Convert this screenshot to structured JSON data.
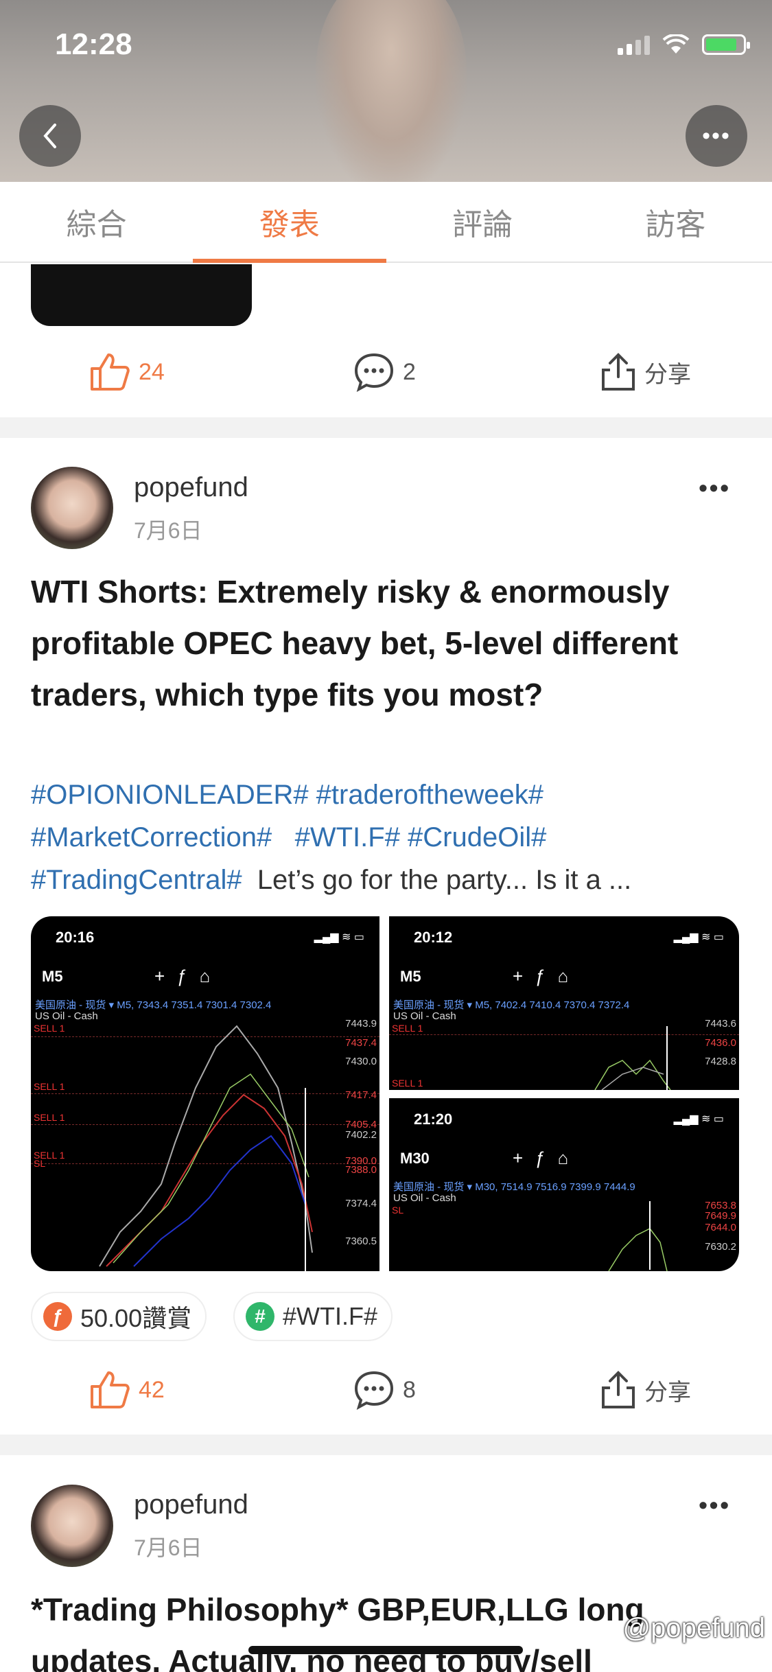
{
  "status_bar": {
    "time": "12:28"
  },
  "tabs": [
    {
      "label": "綜合"
    },
    {
      "label": "發表"
    },
    {
      "label": "評論"
    },
    {
      "label": "訪客"
    }
  ],
  "prev_post": {
    "likes": "24",
    "comments": "2",
    "share_label": "分享"
  },
  "post1": {
    "author": "popefund",
    "date": "7月6日",
    "title": "WTI Shorts: Extremely risky & enormously profitable OPEC heavy bet, 5-level different traders, which type fits you most?",
    "tags_line1": "#OPIONIONLEADER# #traderoftheweek#",
    "tags_line2a": "#MarketCorrection#",
    "tags_line2b": "#WTI.F# #CrudeOil#",
    "tags_line3": "#TradingCentral#",
    "body_text": "Let’s go for the party... Is it a ...",
    "images": {
      "big": {
        "time": "20:16",
        "timeframe": "M5",
        "info": "美国原油 - 现货 ▾ M5, 7343.4 7351.4 7301.4 7302.4",
        "symbol": "US Oil - Cash",
        "sell_labels": [
          "SELL 1",
          "SELL 1",
          "SELL 1",
          "SELL 1",
          "SL"
        ],
        "prices": [
          "7443.9",
          "7437.4",
          "7430.0",
          "7417.4",
          "7405.4",
          "7402.2",
          "7390.0",
          "7388.0",
          "7374.4",
          "7360.5"
        ]
      },
      "top_right": {
        "time": "20:12",
        "timeframe": "M5",
        "info": "美国原油 - 现货 ▾ M5, 7402.4 7410.4 7370.4 7372.4",
        "symbol": "US Oil - Cash",
        "sell_labels": [
          "SELL 1",
          "SELL 1"
        ],
        "prices": [
          "7443.6",
          "7436.0",
          "7428.8"
        ]
      },
      "bottom_right": {
        "time": "21:20",
        "timeframe": "M30",
        "info": "美国原油 - 现货 ▾ M30, 7514.9 7516.9 7399.9 7444.9",
        "symbol": "US Oil - Cash",
        "sell_labels": [
          "SL"
        ],
        "prices": [
          "7653.8",
          "7649.9",
          "7644.0",
          "7630.2"
        ]
      }
    },
    "reward_chip": "50.00讚賞",
    "topic_chip": "#WTI.F#",
    "likes": "42",
    "comments": "8",
    "share_label": "分享"
  },
  "post2": {
    "author": "popefund",
    "date": "7月6日",
    "title_line1": "*Trading Philosophy* GBP,EUR,LLG long",
    "title_line2": "updates. Actually, no need to buy/sell"
  },
  "watermark": "@popefund",
  "colors": {
    "accent": "#ef7a45",
    "tag": "#2f6fb0",
    "divider": "#f2f2f2"
  }
}
